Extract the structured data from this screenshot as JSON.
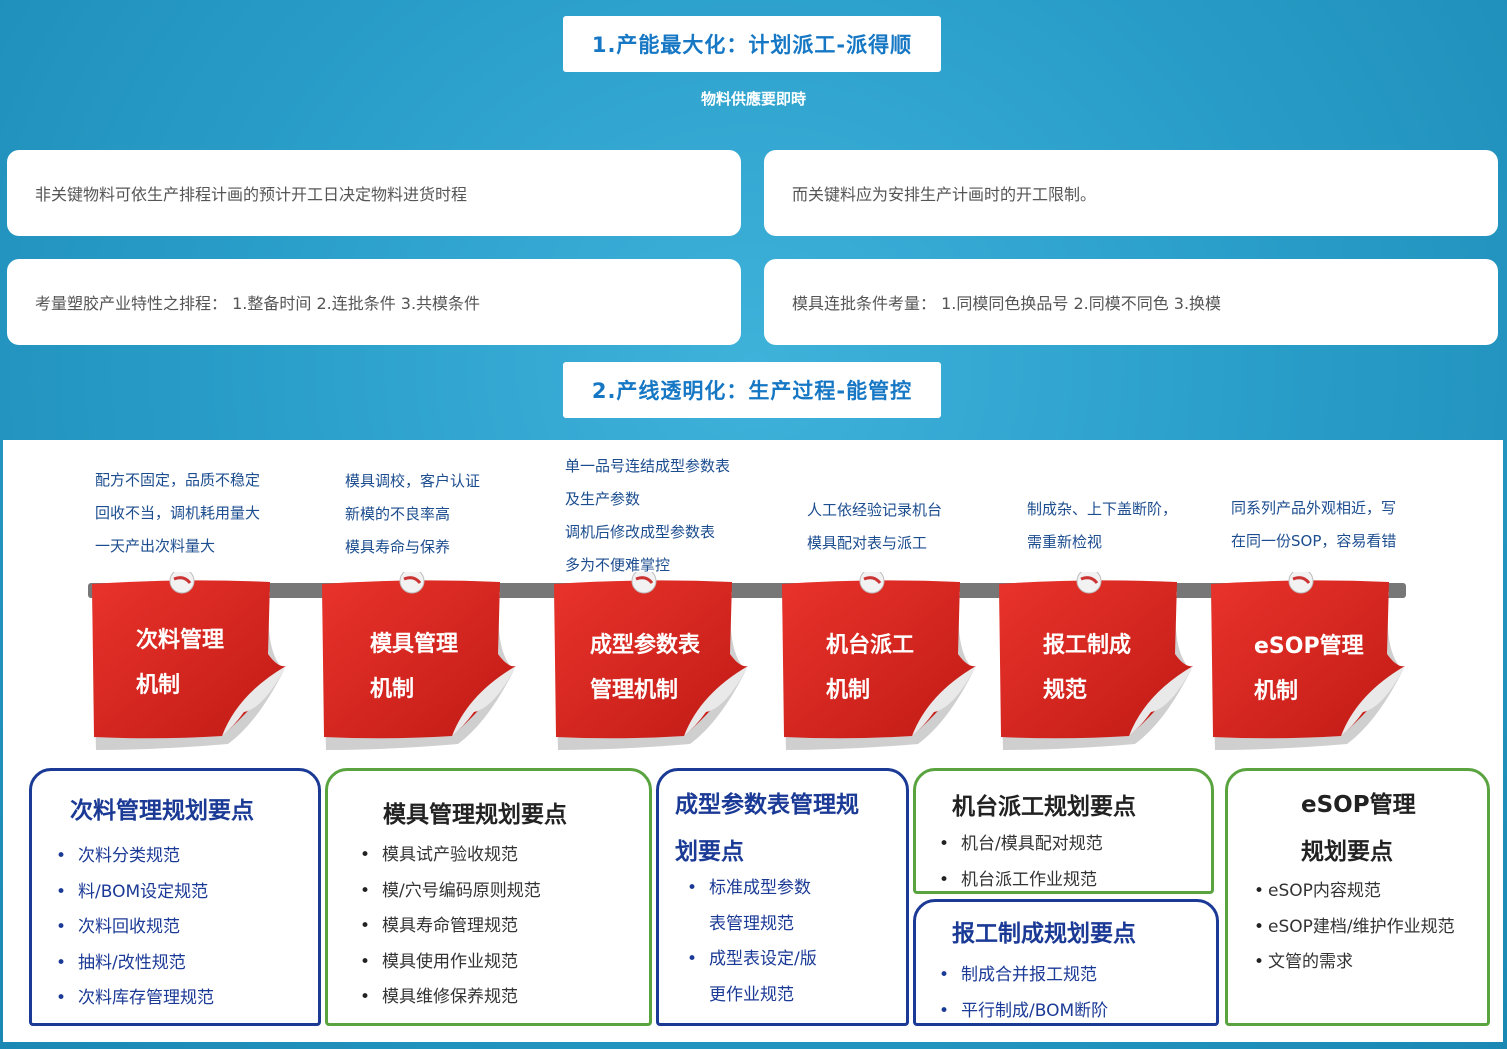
{
  "section1": {
    "title": "1.产能最大化：计划派工-派得顺",
    "subtitle": "物料供應要即時",
    "cards": [
      "非关键物料可依生产排程计画的预计开工日决定物料进货时程",
      "而关键料应为安排生产计画时的开工限制。",
      "考量塑胶产业特性之排程： 1.整备时间    2.连批条件    3.共模条件",
      "模具连批条件考量： 1.同模同色换品号    2.同模不同色    3.换模"
    ]
  },
  "section2": {
    "title": "2.产线透明化：生产过程-能管控"
  },
  "notes": [
    [
      "配方不固定，品质不稳定",
      "回收不当，调机耗用量大",
      "一天产出次料量大"
    ],
    [
      "模具调校，客户认证",
      "新模的不良率高",
      "模具寿命与保养"
    ],
    [
      "单一品号连结成型参数表",
      "及生产参数",
      "调机后修改成型参数表",
      "多为不便难掌控"
    ],
    [
      "人工依经验记录机台",
      "模具配对表与派工"
    ],
    [
      "制成杂、上下盖断阶，",
      "需重新检视"
    ],
    [
      "同系列产品外观相近，写",
      "在同一份SOP，容易看错"
    ]
  ],
  "tags": [
    [
      "次料管理",
      "机制"
    ],
    [
      "模具管理",
      "机制"
    ],
    [
      "成型参数表",
      "管理机制"
    ],
    [
      "机台派工",
      "机制"
    ],
    [
      "报工制成",
      "规范"
    ],
    [
      "eSOP管理",
      "机制"
    ]
  ],
  "boxes": [
    {
      "title": [
        "次料管理规划要点"
      ],
      "items": [
        "次料分类规范",
        "料/BOM设定规范",
        "次料回收规范",
        "抽料/改性规范",
        "次料库存管理规范"
      ]
    },
    {
      "title": [
        "模具管理规划要点"
      ],
      "items": [
        "模具试产验收规范",
        "模/穴号编码原则规范",
        "模具寿命管理规范",
        "模具使用作业规范",
        "模具维修保养规范"
      ]
    },
    {
      "title": [
        "成型参数表管理规",
        "划要点"
      ],
      "items": [
        "标准成型参数",
        "表管理规范",
        "成型表设定/版",
        "更作业规范"
      ]
    },
    {
      "title": [
        "机台派工规划要点"
      ],
      "items": [
        "机台/模具配对规范",
        "机台派工作业规范"
      ]
    },
    {
      "title": [
        "报工制成规划要点"
      ],
      "items": [
        "制成合并报工规范",
        "平行制成/BOM断阶"
      ]
    },
    {
      "title": [
        "eSOP管理",
        "规划要点"
      ],
      "items": [
        "eSOP内容规范",
        "eSOP建档/维护作业规范",
        "文管的需求"
      ]
    }
  ],
  "colors": {
    "background": "#2a9fca",
    "heading_text": "#1677c4",
    "tag_red": "#d7231d",
    "box_blue": "#1b3a96",
    "box_green": "#5aa43f",
    "note_text": "#1c4d8f"
  }
}
